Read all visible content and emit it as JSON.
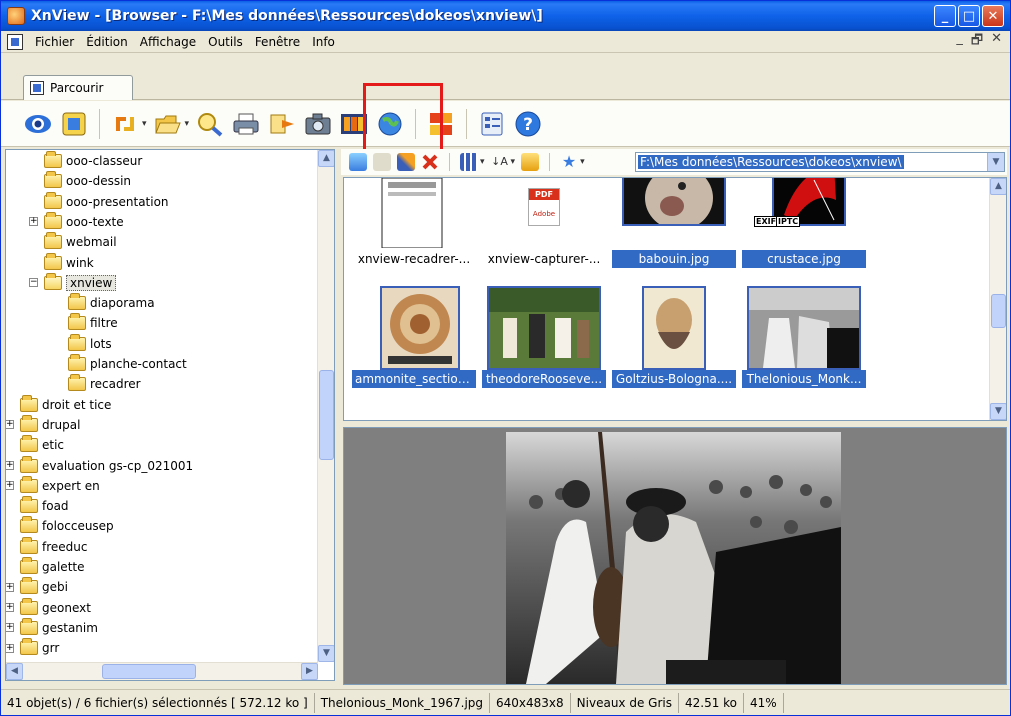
{
  "window": {
    "title": "XnView - [Browser - F:\\Mes données\\Ressources\\dokeos\\xnview\\]",
    "minimize": "_",
    "maximize": "□",
    "close": "✕"
  },
  "menubar": {
    "items": [
      "Fichier",
      "Édition",
      "Affichage",
      "Outils",
      "Fenêtre",
      "Info"
    ],
    "doc_minimize": "_",
    "doc_restore": "🗗",
    "doc_close": "✕"
  },
  "tab": {
    "label": "Parcourir"
  },
  "toolbar": {
    "icons": [
      "eye-icon",
      "fullscreen-icon",
      "rotate-icon",
      "open-folder-icon",
      "search-icon",
      "print-icon",
      "convert-icon",
      "capture-icon",
      "slideshow-icon",
      "web-icon",
      "contact-sheet-icon",
      "info-icon",
      "help-icon"
    ],
    "colors": {
      "highlight": "#e41919"
    }
  },
  "tree": {
    "items": [
      {
        "label": "ooo-classeur",
        "level": 2,
        "expander": ""
      },
      {
        "label": "ooo-dessin",
        "level": 2,
        "expander": ""
      },
      {
        "label": "ooo-presentation",
        "level": 2,
        "expander": ""
      },
      {
        "label": "ooo-texte",
        "level": 2,
        "expander": "+"
      },
      {
        "label": "webmail",
        "level": 2,
        "expander": ""
      },
      {
        "label": "wink",
        "level": 2,
        "expander": ""
      },
      {
        "label": "xnview",
        "level": 2,
        "expander": "−"
      },
      {
        "label": "diaporama",
        "level": 3,
        "expander": ""
      },
      {
        "label": "filtre",
        "level": 3,
        "expander": ""
      },
      {
        "label": "lots",
        "level": 3,
        "expander": ""
      },
      {
        "label": "planche-contact",
        "level": 3,
        "expander": ""
      },
      {
        "label": "recadrer",
        "level": 3,
        "expander": ""
      },
      {
        "label": "droit et tice",
        "level": 1,
        "expander": ""
      },
      {
        "label": "drupal",
        "level": 1,
        "expander": "+"
      },
      {
        "label": "etic",
        "level": 1,
        "expander": ""
      },
      {
        "label": "evaluation gs-cp_021001",
        "level": 1,
        "expander": "+"
      },
      {
        "label": "expert en",
        "level": 1,
        "expander": "+"
      },
      {
        "label": "foad",
        "level": 1,
        "expander": ""
      },
      {
        "label": "folocceusep",
        "level": 1,
        "expander": ""
      },
      {
        "label": "freeduc",
        "level": 1,
        "expander": ""
      },
      {
        "label": "galette",
        "level": 1,
        "expander": ""
      },
      {
        "label": "gebi",
        "level": 1,
        "expander": "+"
      },
      {
        "label": "geonext",
        "level": 1,
        "expander": "+"
      },
      {
        "label": "gestanim",
        "level": 1,
        "expander": "+"
      },
      {
        "label": "grr",
        "level": 1,
        "expander": "+"
      }
    ],
    "selected": "xnview"
  },
  "browse_bar": {
    "path": "F:\\Mes données\\Ressources\\dokeos\\xnview\\"
  },
  "thumbnails": [
    {
      "caption": "xnview-recadrer-...",
      "selected": false,
      "kind": "doc"
    },
    {
      "caption": "xnview-capturer-...",
      "selected": false,
      "kind": "pdf"
    },
    {
      "caption": "babouin.jpg",
      "selected": true,
      "kind": "baboon"
    },
    {
      "caption": "crustace.jpg",
      "selected": true,
      "kind": "crustace"
    },
    {
      "caption": "ammonite_section...",
      "selected": true,
      "kind": "ammonite"
    },
    {
      "caption": "theodoreRooseve...",
      "selected": true,
      "kind": "roosevelt"
    },
    {
      "caption": "Goltzius-Bologna....",
      "selected": true,
      "kind": "goltzius"
    },
    {
      "caption": "Thelonious_Monk...",
      "selected": true,
      "kind": "monk"
    }
  ],
  "badges": {
    "exif": "EXIF",
    "iptc": "IPTC"
  },
  "pdf_label": "PDF",
  "pdf_sub": "Adobe",
  "statusbar": {
    "selection": "41 objet(s) / 6 fichier(s) sélectionnés  [ 572.12 ko ]",
    "filename": "Thelonious_Monk_1967.jpg",
    "dimensions": "640x483x8",
    "mode": "Niveaux de Gris",
    "size": "42.51 ko",
    "zoom": "41%"
  }
}
